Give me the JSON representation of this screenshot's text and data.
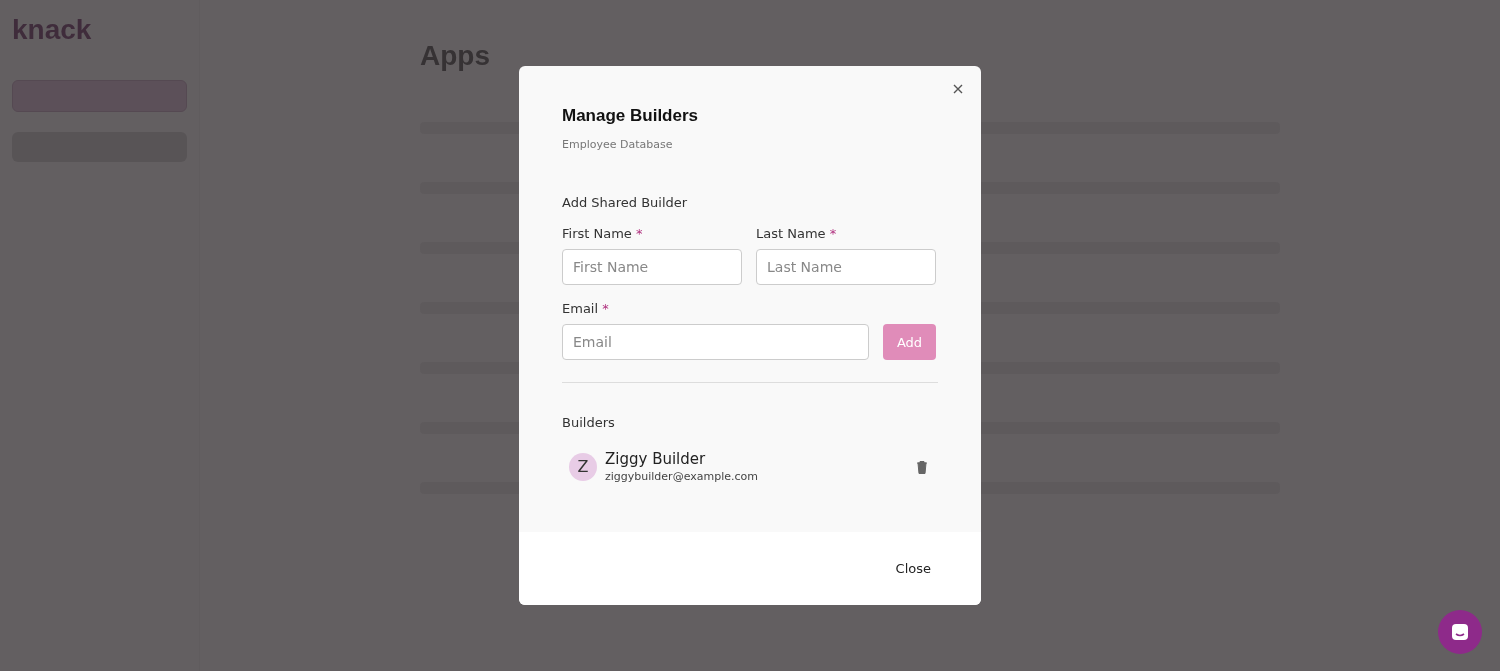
{
  "background": {
    "logo": "knack",
    "title": "Apps"
  },
  "modal": {
    "title": "Manage Builders",
    "subtitle": "Employee Database",
    "section_title": "Add Shared Builder",
    "name_fields": [
      {
        "label": "First Name",
        "required_mark": "*",
        "placeholder": "First Name"
      },
      {
        "label": "Last Name",
        "required_mark": "*",
        "placeholder": "Last Name"
      }
    ],
    "email_field": {
      "label": "Email",
      "required_mark": "*",
      "placeholder": "Email"
    },
    "add_button": {
      "label": "Add",
      "disabled": true
    },
    "builders_title": "Builders",
    "builders": [
      {
        "initial": "Z",
        "name": "Ziggy Builder",
        "email": "ziggybuilder@example.com"
      }
    ],
    "close_button": "Close"
  }
}
